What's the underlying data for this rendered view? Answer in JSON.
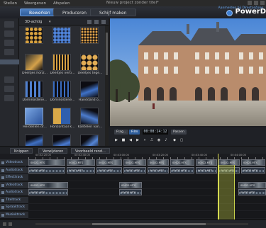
{
  "menu": {
    "items": [
      "Stellen",
      "Weergeven",
      "Afspelen"
    ],
    "window_title": "Nieuw project zonder titel*"
  },
  "header": {
    "tabs": [
      {
        "label": "Bewerken",
        "active": true
      },
      {
        "label": "Produceren",
        "active": false
      },
      {
        "label": "Schijf maken",
        "active": false
      }
    ],
    "brand": "PowerD",
    "account_link": "Aanmelden bij DirectorZone"
  },
  "library": {
    "category": "3D-achtig",
    "items": [
      {
        "label": ""
      },
      {
        "label": ""
      },
      {
        "label": ""
      },
      {
        "label": "Deeltjes horiz..."
      },
      {
        "label": "Deeltjes verti..."
      },
      {
        "label": "Deeltjes tege..."
      },
      {
        "label": "Dominostene..."
      },
      {
        "label": "Dominostene..."
      },
      {
        "label": "Handdand o..."
      },
      {
        "label": "Herdelllen dr..."
      },
      {
        "label": "Horizontaal k..."
      },
      {
        "label": "Kantelen van..."
      },
      {
        "label": "Kantelen om..."
      },
      {
        "label": "Kantelen om..."
      },
      {
        "label": "Kantelen van..."
      },
      {
        "label": ""
      },
      {
        "label": ""
      },
      {
        "label": ""
      }
    ]
  },
  "preview": {
    "frag_label": "Frag...",
    "film_label": "Film",
    "timecode": "00:08:24:12",
    "fit_label": "Passen"
  },
  "timeline": {
    "buttons": [
      "Knippen",
      "Verwijderen",
      "Voorbeeld rend..."
    ],
    "ruler_labels": [
      "00:02:20:00",
      "00:02:40:00",
      "00:03:00:00",
      "00:03:20:00",
      "00:03:40:00",
      "00:04:00:00"
    ],
    "track_labels": [
      "Videotrack",
      "Audiotrack",
      "Effecttrack",
      "Videotrack",
      "Audiotrack",
      "Titeltrack",
      "Spraaktrack",
      "Muziektrack"
    ],
    "clip_label": "00022.MTS"
  },
  "colors": {
    "accent": "#2f5e9c",
    "highlight": "#c8d24a"
  }
}
